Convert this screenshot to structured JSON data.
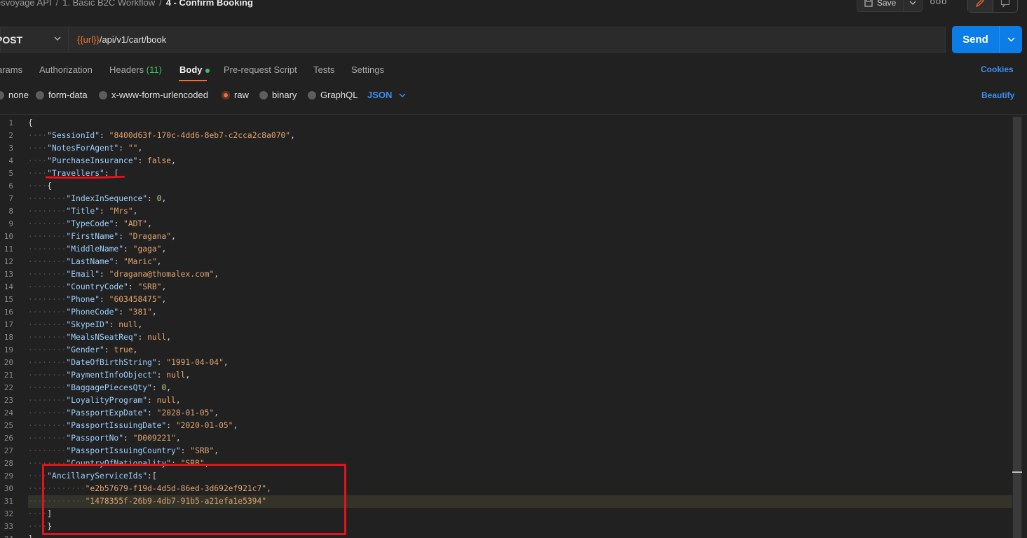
{
  "breadcrumb": {
    "items": [
      "esvoyage API",
      "1. Basic B2C Workflow"
    ],
    "current": "4 - Confirm Booking",
    "separator": "/"
  },
  "toolbar": {
    "save_label": "Save",
    "more_label": "ooo"
  },
  "request": {
    "method": "POST",
    "url_variable": "{{url}}",
    "url_path": "/api/v1/cart/book",
    "send_label": "Send"
  },
  "tabs": [
    {
      "label": "Params",
      "shown": "arams"
    },
    {
      "label": "Authorization"
    },
    {
      "label": "Headers",
      "count": "(11)"
    },
    {
      "label": "Body",
      "active": true
    },
    {
      "label": "Pre-request Script"
    },
    {
      "label": "Tests"
    },
    {
      "label": "Settings"
    }
  ],
  "cookies_label": "Cookies",
  "body_options": {
    "options": [
      "none",
      "form-data",
      "x-www-form-urlencoded",
      "raw",
      "binary",
      "GraphQL"
    ],
    "selected": "raw",
    "format": "JSON",
    "beautify_label": "Beautify"
  },
  "colors": {
    "accent_orange": "#f26b3a",
    "link_blue": "#3d8fee",
    "send_blue": "#0c7ce6",
    "count_green": "#3ebd68",
    "annotation_red": "#e8101a"
  },
  "editor": {
    "highlighted_line": 31,
    "lines": [
      {
        "n": 1,
        "indent": 0,
        "text": "{"
      },
      {
        "n": 2,
        "indent": 1,
        "key": "SessionId",
        "value": "\"8400d63f-170c-4dd6-8eb7-c2cca2c8a070\"",
        "vtype": "s"
      },
      {
        "n": 3,
        "indent": 1,
        "key": "NotesForAgent",
        "value": "\"\"",
        "vtype": "s"
      },
      {
        "n": 4,
        "indent": 1,
        "key": "PurchaseInsurance",
        "value": "false",
        "vtype": "kw"
      },
      {
        "n": 5,
        "indent": 1,
        "key": "Travellers",
        "value": "[",
        "vtype": "p",
        "nocomma": true
      },
      {
        "n": 6,
        "indent": 1,
        "text": "{"
      },
      {
        "n": 7,
        "indent": 2,
        "key": "IndexInSequence",
        "value": "0",
        "vtype": "n"
      },
      {
        "n": 8,
        "indent": 2,
        "key": "Title",
        "value": "\"Mrs\"",
        "vtype": "s"
      },
      {
        "n": 9,
        "indent": 2,
        "key": "TypeCode",
        "value": "\"ADT\"",
        "vtype": "s"
      },
      {
        "n": 10,
        "indent": 2,
        "key": "FirstName",
        "value": "\"Dragana\"",
        "vtype": "s"
      },
      {
        "n": 11,
        "indent": 2,
        "key": "MiddleName",
        "value": "\"gaga\"",
        "vtype": "s"
      },
      {
        "n": 12,
        "indent": 2,
        "key": "LastName",
        "value": "\"Maric\"",
        "vtype": "s"
      },
      {
        "n": 13,
        "indent": 2,
        "key": "Email",
        "value": "\"dragana@thomalex.com\"",
        "vtype": "s"
      },
      {
        "n": 14,
        "indent": 2,
        "key": "CountryCode",
        "value": "\"SRB\"",
        "vtype": "s"
      },
      {
        "n": 15,
        "indent": 2,
        "key": "Phone",
        "value": "\"603458475\"",
        "vtype": "s"
      },
      {
        "n": 16,
        "indent": 2,
        "key": "PhoneCode",
        "value": "\"381\"",
        "vtype": "s"
      },
      {
        "n": 17,
        "indent": 2,
        "key": "SkypeID",
        "value": "null",
        "vtype": "kw"
      },
      {
        "n": 18,
        "indent": 2,
        "key": "MealsNSeatReq",
        "value": "null",
        "vtype": "kw"
      },
      {
        "n": 19,
        "indent": 2,
        "key": "Gender",
        "value": "true",
        "vtype": "kw"
      },
      {
        "n": 20,
        "indent": 2,
        "key": "DateOfBirthString",
        "value": "\"1991-04-04\"",
        "vtype": "s"
      },
      {
        "n": 21,
        "indent": 2,
        "key": "PaymentInfoObject",
        "value": "null",
        "vtype": "kw"
      },
      {
        "n": 22,
        "indent": 2,
        "key": "BaggagePiecesQty",
        "value": "0",
        "vtype": "n"
      },
      {
        "n": 23,
        "indent": 2,
        "key": "LoyalityProgram",
        "value": "null",
        "vtype": "kw"
      },
      {
        "n": 24,
        "indent": 2,
        "key": "PassportExpDate",
        "value": "\"2028-01-05\"",
        "vtype": "s"
      },
      {
        "n": 25,
        "indent": 2,
        "key": "PassportIssuingDate",
        "value": "\"2020-01-05\"",
        "vtype": "s"
      },
      {
        "n": 26,
        "indent": 2,
        "key": "PassportNo",
        "value": "\"D009221\"",
        "vtype": "s"
      },
      {
        "n": 27,
        "indent": 2,
        "key": "PassportIssuingCountry",
        "value": "\"SRB\"",
        "vtype": "s"
      },
      {
        "n": 28,
        "indent": 2,
        "key": "CountryOfNationality",
        "value": "\"SRB\"",
        "vtype": "s"
      },
      {
        "n": 29,
        "indent": 1,
        "key": "AncillaryServiceIds",
        "value": "[",
        "vtype": "p",
        "nocomma": true,
        "nospace": true
      },
      {
        "n": 30,
        "indent": 3,
        "text": "\"e2b57679-f19d-4d5d-86ed-3d692ef921c7\",",
        "vtype": "s"
      },
      {
        "n": 31,
        "indent": 3,
        "text": "\"1478355f-26b9-4db7-91b5-a21efa1e5394\"",
        "vtype": "s"
      },
      {
        "n": 32,
        "indent": 1,
        "text": "]"
      },
      {
        "n": 33,
        "indent": 1,
        "text": "}"
      },
      {
        "n": 34,
        "indent": 0,
        "text": "]"
      }
    ]
  }
}
